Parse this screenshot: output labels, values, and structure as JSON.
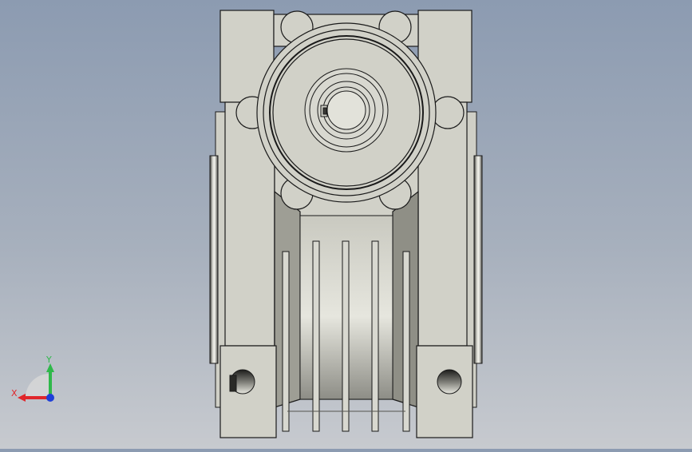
{
  "viewport": {
    "background_top": "#8c9bb1",
    "background_bottom": "#c7cacf"
  },
  "model": {
    "body_color": "#d1d1c8",
    "shade_color": "#a9a99f",
    "edge_color": "#1a1a1a",
    "icon": "worm-gearbox-front-view"
  },
  "triad": {
    "x_label": "X",
    "y_label": "Y",
    "x_color": "#e0262b",
    "y_color": "#2fb84a",
    "z_color": "#1f3fd8"
  }
}
